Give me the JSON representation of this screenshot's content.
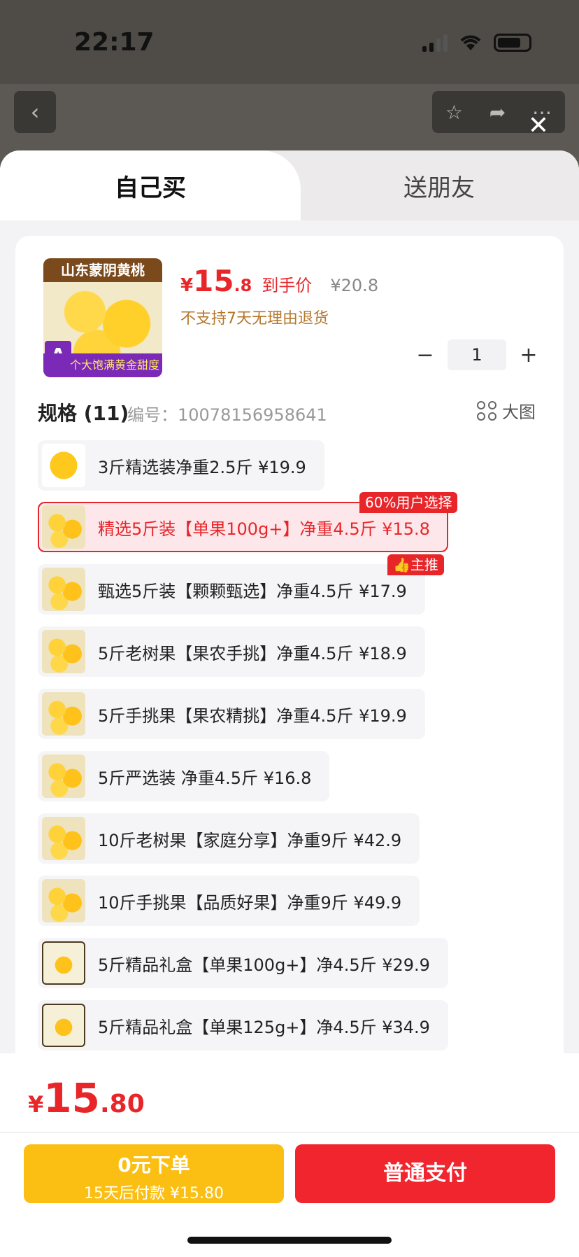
{
  "status_bar": {
    "time": "22:17"
  },
  "sheet": {
    "tabs": [
      {
        "label": "自己买",
        "active": true
      },
      {
        "label": "送朋友",
        "active": false
      }
    ],
    "product": {
      "image_banner": "山东蒙阴黄桃",
      "image_footer": "个大饱满黄金甜度",
      "image_grade": "A",
      "price_symbol": "¥",
      "price_int": "15",
      "price_dec": ".8",
      "price_tag": "到手价",
      "original_price": "¥20.8",
      "return_note": "不支持7天无理由退货",
      "quantity": "1",
      "qty_minus": "−",
      "qty_plus": "+"
    },
    "spec": {
      "title": "规格 (11)",
      "code_label": "编号：10078156958641",
      "big_image_label": "大图"
    },
    "options": [
      {
        "label": "3斤精选装净重2.5斤   ¥19.9"
      },
      {
        "label": "精选5斤装【单果100g+】净重4.5斤   ¥15.8",
        "badge": "60%用户选择",
        "selected": true
      },
      {
        "label": "甄选5斤装【颗颗甄选】净重4.5斤   ¥17.9",
        "badge": "主推"
      },
      {
        "label": "5斤老树果【果农手挑】净重4.5斤   ¥18.9"
      },
      {
        "label": "5斤手挑果【果农精挑】净重4.5斤   ¥19.9"
      },
      {
        "label": "5斤严选装 净重4.5斤   ¥16.8"
      },
      {
        "label": "10斤老树果【家庭分享】净重9斤   ¥42.9"
      },
      {
        "label": "10斤手挑果【品质好果】净重9斤   ¥49.9"
      },
      {
        "label": "5斤精品礼盒【单果100g+】净4.5斤   ¥29.9"
      },
      {
        "label": "5斤精品礼盒【单果125g+】净4.5斤   ¥34.9"
      }
    ]
  },
  "bottom": {
    "total_symbol": "¥",
    "total_int": "15",
    "total_dec": ".80",
    "pay_later_line1": "0元下单",
    "pay_later_line2": "15天后付款 ¥15.80",
    "pay_now": "普通支付"
  },
  "colors": {
    "accent": "#e8262a",
    "pay_later": "#fbbf14",
    "pay_now": "#f0252e"
  }
}
